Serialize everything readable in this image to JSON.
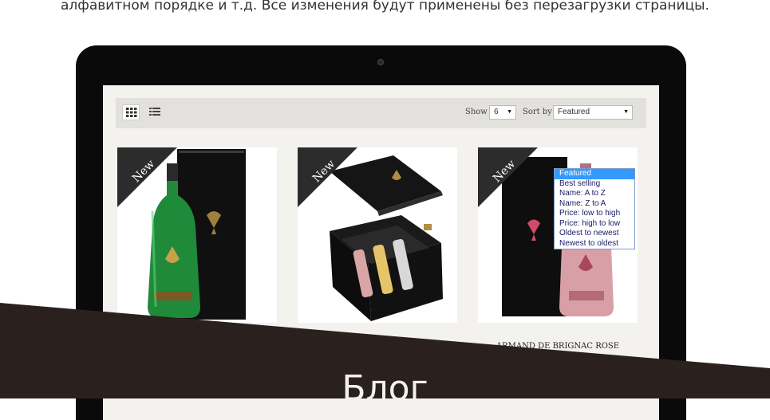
{
  "intro": {
    "text": "алфавитном порядке и т.д. Все изменения будут применены без перезагрузки страницы."
  },
  "toolbar": {
    "grid_icon": "grid-view-icon",
    "list_icon": "list-view-icon",
    "show_label": "Show",
    "show_value": "6",
    "sort_label": "Sort by",
    "sort_value": "Featured"
  },
  "sort_options": [
    "Featured",
    "Best selling",
    "Name: A to Z",
    "Name: Z to A",
    "Price: low to high",
    "Price: high to low",
    "Oldest to newest",
    "Newest to oldest"
  ],
  "products": [
    {
      "badge": "New"
    },
    {
      "badge": "New"
    },
    {
      "badge": "New",
      "title": "ARMAND DE BRIGNAC ROSE"
    }
  ],
  "section": {
    "title": "Блог"
  },
  "colors": {
    "band": "#2a211e",
    "ribbon": "#2c2c2c",
    "dropdown_selected": "#3399ff"
  }
}
